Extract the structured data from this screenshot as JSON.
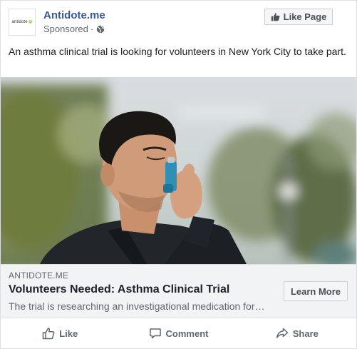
{
  "header": {
    "page_name": "Antidote.me",
    "logo_text": "antidote",
    "sponsored_label": "Sponsored",
    "sponsored_separator": "·",
    "like_page_label": "Like Page"
  },
  "post": {
    "text": "An asthma clinical trial is looking for volunteers in New York City to take part."
  },
  "link": {
    "domain": "ANTIDOTE.ME",
    "headline": "Volunteers Needed: Asthma Clinical Trial",
    "description": "The trial is researching an investigational medication for…",
    "cta_label": "Learn More"
  },
  "actions": {
    "like_label": "Like",
    "comment_label": "Comment",
    "share_label": "Share"
  },
  "colors": {
    "page_name": "#385898",
    "brand_green": "#7cc13a",
    "inhaler": "#2f8fb5"
  },
  "icons": {
    "privacy": "globe-icon",
    "like_page": "thumbs-up-icon",
    "like": "thumbs-up-outline-icon",
    "comment": "comment-bubble-icon",
    "share": "share-arrow-icon"
  }
}
